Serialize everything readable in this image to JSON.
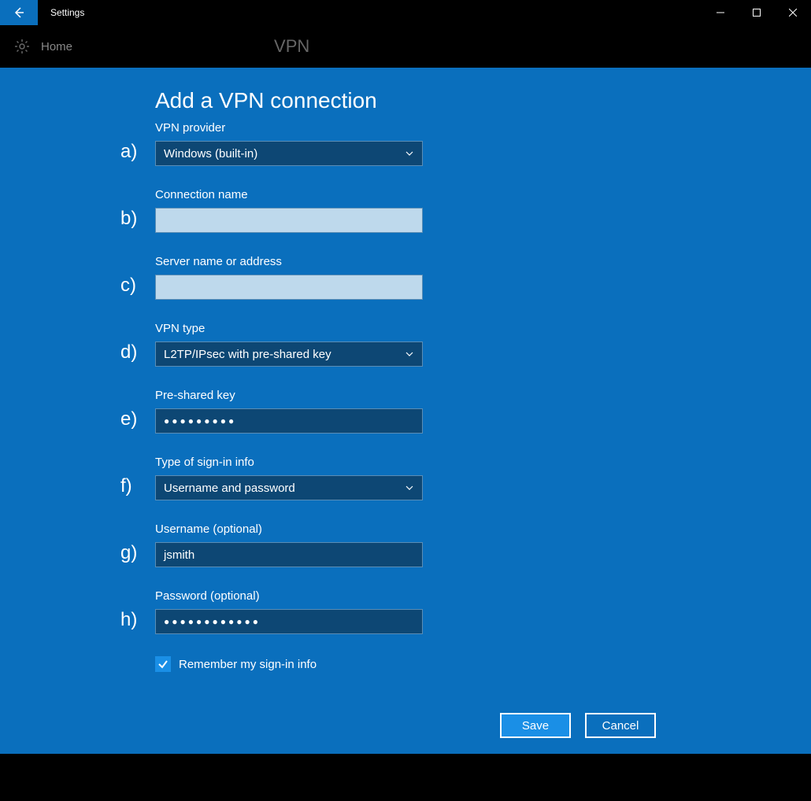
{
  "window": {
    "title": "Settings"
  },
  "breadcrumb": {
    "home": "Home",
    "page": "VPN"
  },
  "heading": "Add a VPN connection",
  "markers": {
    "a": "a)",
    "b": "b)",
    "c": "c)",
    "d": "d)",
    "e": "e)",
    "f": "f)",
    "g": "g)",
    "h": "h)"
  },
  "form": {
    "vpn_provider": {
      "label": "VPN provider",
      "value": "Windows (built-in)"
    },
    "connection_name": {
      "label": "Connection name",
      "value": ""
    },
    "server": {
      "label": "Server name or address",
      "value": ""
    },
    "vpn_type": {
      "label": "VPN type",
      "value": "L2TP/IPsec with pre-shared key"
    },
    "psk": {
      "label": "Pre-shared key",
      "value": "●●●●●●●●●"
    },
    "signin_type": {
      "label": "Type of sign-in info",
      "value": "Username and password"
    },
    "username": {
      "label": "Username (optional)",
      "value": "jsmith"
    },
    "password": {
      "label": "Password (optional)",
      "value": "●●●●●●●●●●●●"
    },
    "remember": {
      "label": "Remember my sign-in info",
      "checked": true
    }
  },
  "buttons": {
    "save": "Save",
    "cancel": "Cancel"
  }
}
